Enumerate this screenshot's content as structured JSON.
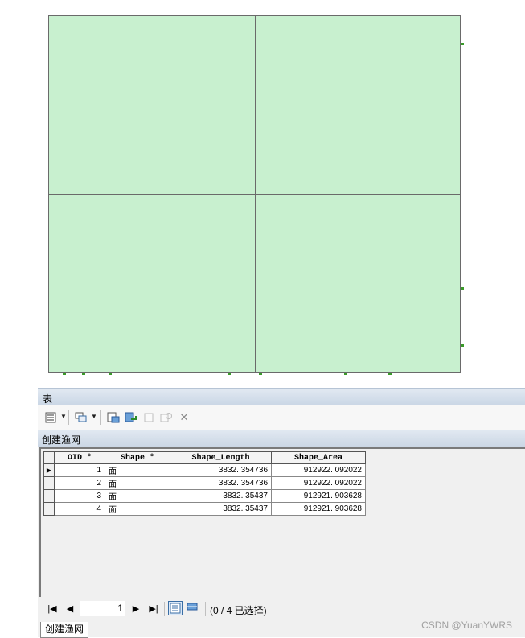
{
  "window": {
    "title": "表"
  },
  "layer": {
    "name": "创建渔网"
  },
  "icons": [
    "table-options-icon",
    "related-tables-icon",
    "select-by-attributes-icon",
    "switch-selection-icon",
    "clear-selection-icon",
    "zoom-to-selected-icon",
    "delete-selected-icon"
  ],
  "table": {
    "columns": [
      "OID *",
      "Shape *",
      "Shape_Length",
      "Shape_Area"
    ],
    "rows": [
      [
        "1",
        "面",
        "3832. 354736",
        "912922. 092022"
      ],
      [
        "2",
        "面",
        "3832. 354736",
        "912922. 092022"
      ],
      [
        "3",
        "面",
        "3832. 35437",
        "912921. 903628"
      ],
      [
        "4",
        "面",
        "3832. 35437",
        "912921. 903628"
      ]
    ]
  },
  "navigation": {
    "current_record": "1",
    "selection_text": "(0 / 4 已选择)"
  },
  "tab": {
    "label": "创建渔网"
  },
  "watermark": "CSDN @YuanYWRS",
  "colors": {
    "polygon_fill": "#c8f0cf",
    "polygon_edge": "#6a6a6a",
    "vertex_marker": "#3a9a2a",
    "title_bar": "#cad6e4"
  }
}
